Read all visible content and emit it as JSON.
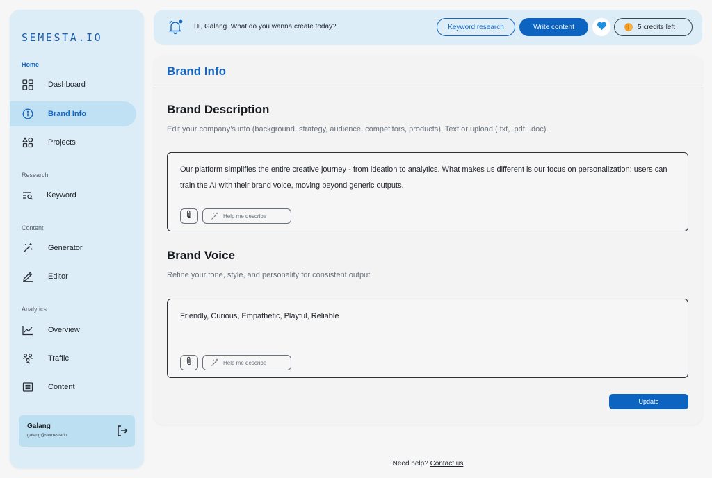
{
  "brand": {
    "logo_text": "SEMESTA.IO"
  },
  "sidebar": {
    "sections": [
      {
        "label": "Home"
      },
      {
        "label": "Research"
      },
      {
        "label": "Content"
      },
      {
        "label": "Analytics"
      }
    ],
    "items": [
      {
        "label": "Dashboard",
        "icon": "grid-icon",
        "active": false
      },
      {
        "label": "Brand Info",
        "icon": "info-icon",
        "active": true
      },
      {
        "label": "Projects",
        "icon": "shapes-icon",
        "active": false
      },
      {
        "label": "Keyword",
        "icon": "list-search-icon",
        "active": false
      },
      {
        "label": "Generator",
        "icon": "magic-wand-icon",
        "active": false
      },
      {
        "label": "Editor",
        "icon": "pencil-icon",
        "active": false
      },
      {
        "label": "Overview",
        "icon": "line-chart-icon",
        "active": false
      },
      {
        "label": "Traffic",
        "icon": "users-icon",
        "active": false
      },
      {
        "label": "Content",
        "icon": "document-icon",
        "active": false
      }
    ],
    "user": {
      "name": "Galang",
      "email": "galang@semesta.io"
    }
  },
  "topbar": {
    "greeting": "Hi, Galang. What do you wanna create today?",
    "keyword_button": "Keyword research",
    "write_button": "Write content",
    "credits": "5 credits left"
  },
  "main": {
    "title": "Brand Info",
    "brand_description": {
      "heading": "Brand Description",
      "description": "Edit  your company’s info (background, strategy, audience, competitors, products). Text or upload (.txt, .pdf, .doc).",
      "value": "Our platform simplifies the entire creative journey - from ideation to analytics. What makes us different is our focus on personalization: users can train the AI with their brand voice, moving beyond generic outputs.",
      "help_label": "Help me describe"
    },
    "brand_voice": {
      "heading": "Brand Voice",
      "description": "Refine your tone, style, and personality for consistent output.",
      "value": "Friendly, Curious, Empathetic, Playful, Reliable",
      "help_label": "Help me describe"
    },
    "update_button": "Update"
  },
  "footer": {
    "text": "Need help?",
    "link": "Contact us"
  },
  "colors": {
    "accent": "#1466c2",
    "primary_button": "#0d64c0",
    "sidebar_bg": "#dcedf8",
    "active_item_bg": "#bfe1f3",
    "notification_dot": "#1466c2",
    "coin": "#f39a1e"
  }
}
